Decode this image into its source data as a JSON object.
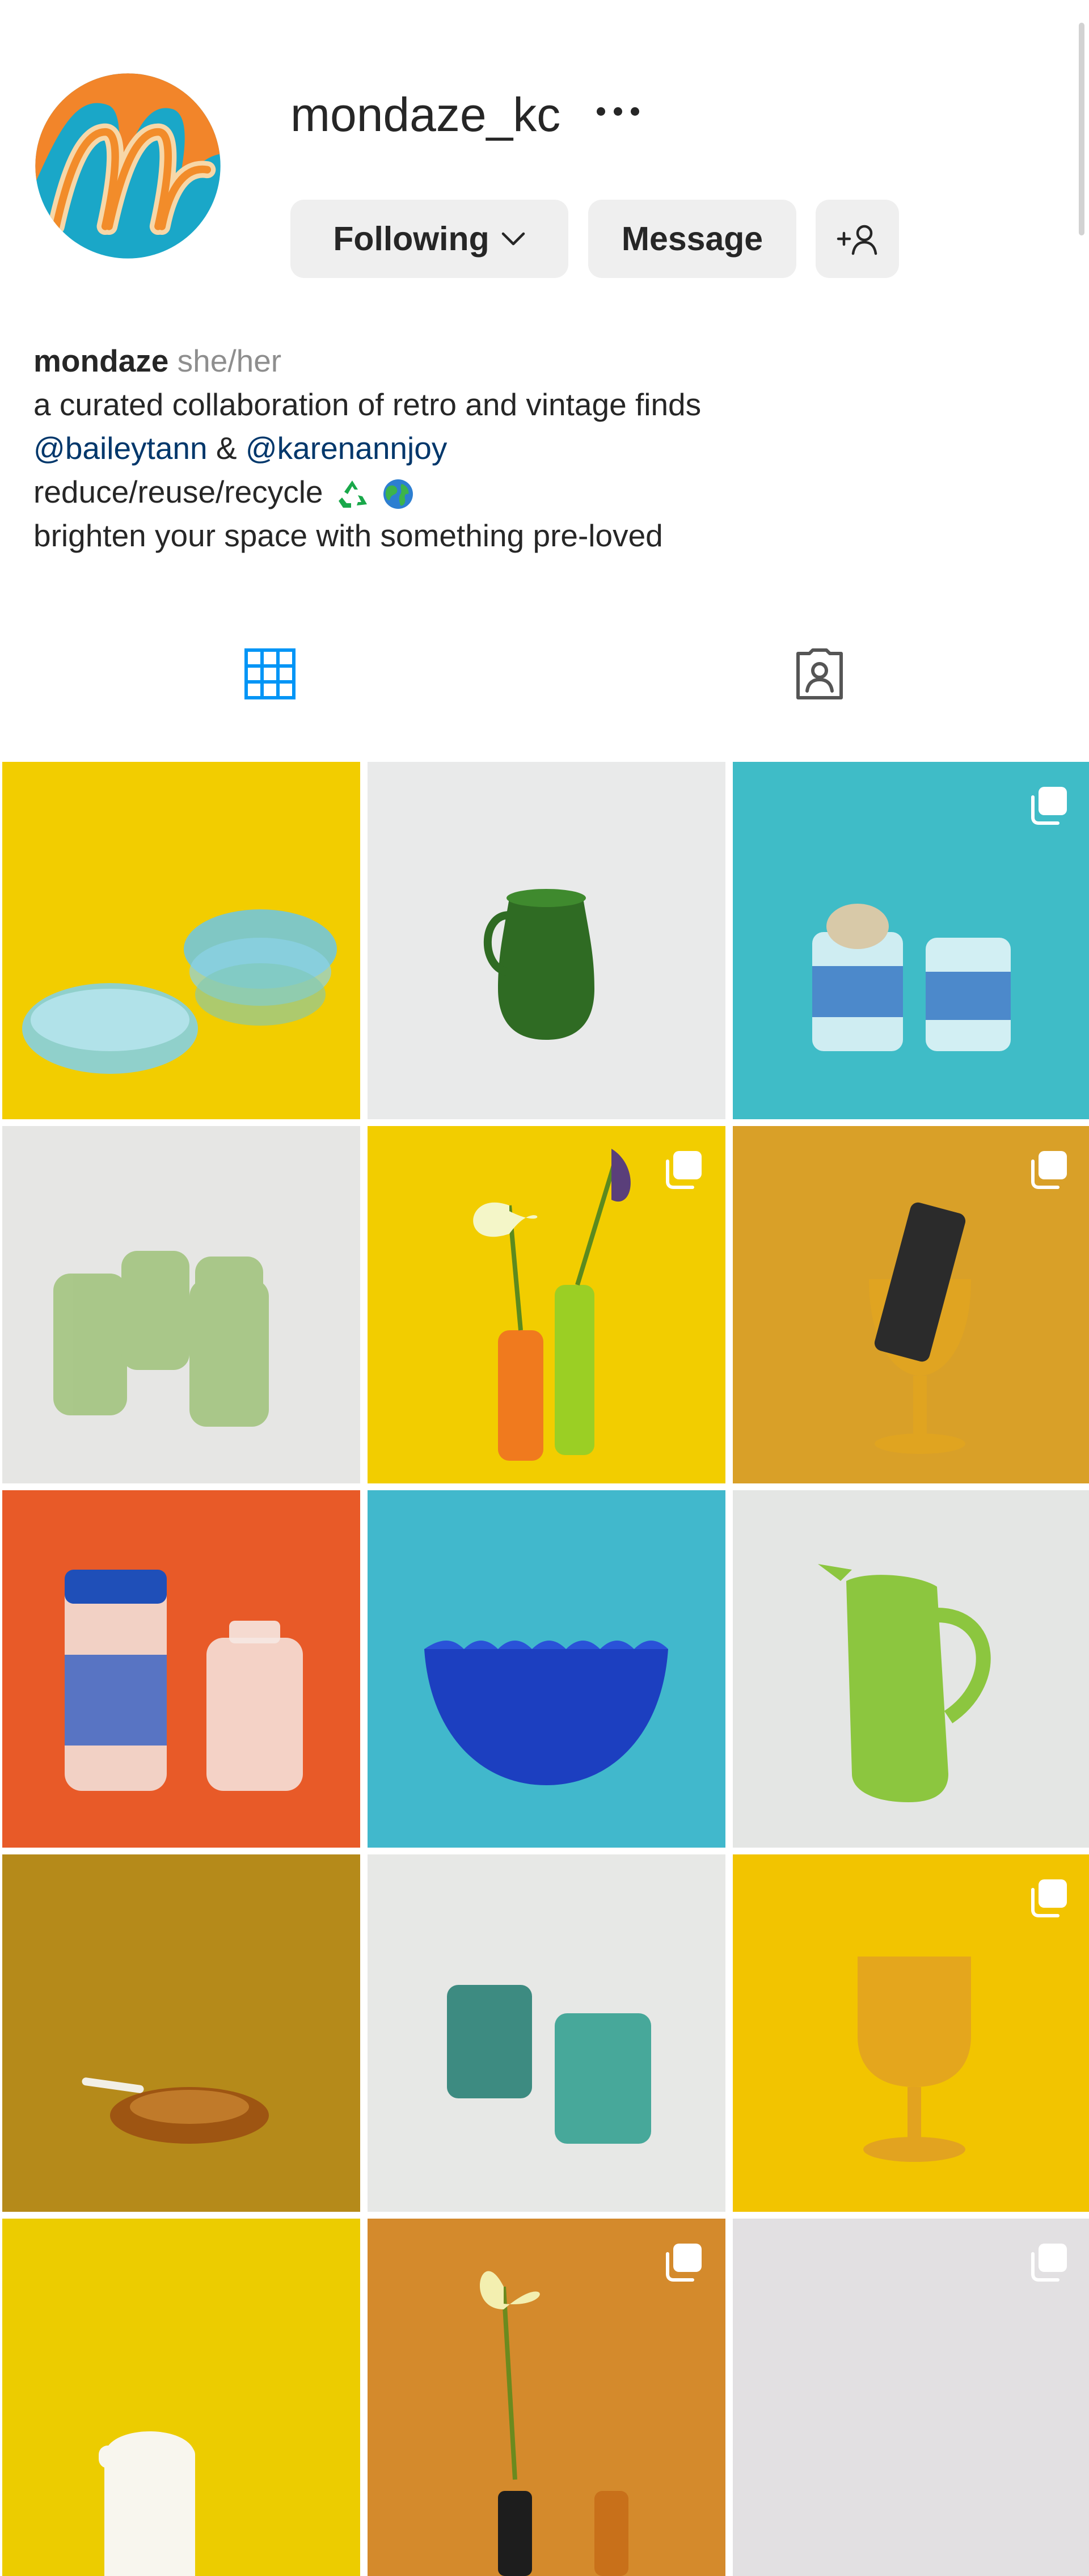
{
  "profile": {
    "username": "mondaze_kc",
    "buttons": {
      "following": "Following",
      "message": "Message"
    },
    "bio": {
      "name": "mondaze",
      "pronouns": "she/her",
      "line1": "a curated collaboration of retro and vintage finds",
      "mention1": "@baileytann",
      "amp": "&",
      "mention2": "@karenannjoy",
      "line3": "reduce/reuse/recycle",
      "line4": "brighten your space with something pre-loved"
    }
  },
  "icons": {
    "more": "more-options-icon",
    "add_user": "add-user-icon",
    "grid_tab": "grid-icon",
    "tagged_tab": "tagged-icon",
    "multi": "multiple-photos-icon"
  },
  "colors": {
    "accent_blue": "#0095f6",
    "link": "#00376b",
    "button_bg": "#efefef",
    "muted": "#8e8e8e"
  },
  "posts": [
    {
      "subject": "blue glass bowls",
      "bg": "#f2cd00",
      "multi": false
    },
    {
      "subject": "green glass pitcher",
      "bg": "#e9eaea",
      "multi": false
    },
    {
      "subject": "blue printed glass candle jars",
      "bg": "#3fbcc7",
      "multi": true
    },
    {
      "subject": "green glass mugs",
      "bg": "#e6e6e4",
      "multi": false
    },
    {
      "subject": "lilies in orange and green vases",
      "bg": "#f2cd00",
      "multi": true
    },
    {
      "subject": "amber goblet holding phone",
      "bg": "#d9a028",
      "multi": true
    },
    {
      "subject": "blue and white storage jars",
      "bg": "#e85a28",
      "multi": false
    },
    {
      "subject": "cobalt blue glass bowl",
      "bg": "#41b8cc",
      "multi": false
    },
    {
      "subject": "green glass water pitcher",
      "bg": "#e4e6e4",
      "multi": false
    },
    {
      "subject": "amber glass ashtray",
      "bg": "#b58a1a",
      "multi": false
    },
    {
      "subject": "teal glass tumblers",
      "bg": "#e7e8e6",
      "multi": false
    },
    {
      "subject": "amber glass goblet",
      "bg": "#f2c400",
      "multi": true
    },
    {
      "subject": "white lidded pitcher",
      "bg": "#eccc00",
      "multi": false
    },
    {
      "subject": "flowers in amber vase",
      "bg": "#d48a2c",
      "multi": true
    },
    {
      "subject": "light grey",
      "bg": "#e2e0e2",
      "multi": true
    }
  ]
}
